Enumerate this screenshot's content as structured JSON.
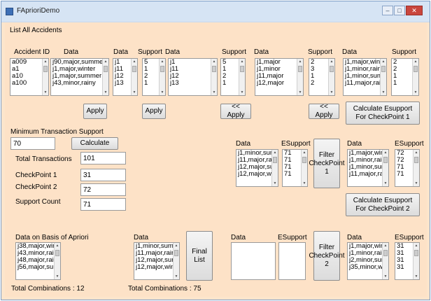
{
  "window": {
    "title": "FAprioriDemo",
    "min": "–",
    "max": "□",
    "close": "✕"
  },
  "section_title": "List All Accidents",
  "col_labels": {
    "accident_id": "Accident ID",
    "data1": "Data",
    "data2": "Data",
    "support1": "Support",
    "data3": "Data",
    "support2": "Support",
    "data4": "Data",
    "support3": "Support",
    "data5": "Data",
    "support4": "Support"
  },
  "lists": {
    "accident_ids": [
      "a009",
      "a1",
      "a10",
      "a100"
    ],
    "data1": [
      "j90,major,summer",
      "j1,major,winter",
      "j1,major,summer",
      "j43,minor,rainy"
    ],
    "data2": [
      "j1",
      "j11",
      "j12",
      "j13"
    ],
    "support1": [
      "5",
      "1",
      "2",
      "1"
    ],
    "data3": [
      "j1",
      "j11",
      "j12",
      "j13"
    ],
    "support2": [
      "5",
      "1",
      "2",
      "1"
    ],
    "data4": [
      "j1,major",
      "j1,minor",
      "j11,major",
      "j12,major"
    ],
    "support3": [
      "2",
      "3",
      "1",
      "2"
    ],
    "data5": [
      "j1,major,winter",
      "j1,minor,rainy",
      "j1,minor,summ",
      "j11,major,rainy"
    ],
    "support4": [
      "2",
      "2",
      "1",
      "1"
    ],
    "filter1_data": [
      "j1,minor,summ",
      "j11,major,rainy",
      "j12,major,sumi",
      "j12,major,winte"
    ],
    "filter1_esupport": [
      "71",
      "71",
      "71",
      "71"
    ],
    "cp1_data": [
      "j1,major,winter",
      "j1,minor,rainy",
      "j1,minor,summ",
      "j11,major,rainy"
    ],
    "cp1_esupport": [
      "72",
      "72",
      "71",
      "71"
    ],
    "apriori": [
      "j38,major,winte",
      "j43,minor,rainy",
      "j48,major,rainy",
      "j56,major,sumi"
    ],
    "final_data": [
      "j1,minor,summ",
      "j11,major,rainy",
      "j12,major,sumi",
      "j12,major,winte"
    ],
    "cp2_data": [
      "j1,major,winter",
      "j1,minor,rainy",
      "j2,minor,summ",
      "j35,minor,winte"
    ],
    "cp2_esupport": [
      "31",
      "31",
      "31",
      "31"
    ]
  },
  "buttons": {
    "apply1": "Apply",
    "apply2": "Apply",
    "apply_back1": "<< Apply",
    "apply_back2": "<< Apply",
    "calc_cp1": "Calculate Esupport For CheckPoint 1",
    "calculate": "Calculate",
    "filter_cp1": "Filter CheckPoint 1",
    "calc_cp2": "Calculate Esupport For CheckPoint 2",
    "final_list": "Final List",
    "filter_cp2": "Filter CheckPoint 2"
  },
  "form": {
    "min_support_label": "Minimum Transaction Support",
    "min_support_value": "70",
    "total_tx_label": "Total Transactions",
    "total_tx_value": "101",
    "cp1_label": "CheckPoint 1",
    "cp1_value": "31",
    "cp2_label": "CheckPoint 2",
    "cp2_value": "72",
    "support_count_label": "Support Count",
    "support_count_value": "71"
  },
  "right_labels": {
    "data_a": "Data",
    "esupport_a": "ESupport",
    "data_b": "Data",
    "esupport_b": "ESupport",
    "data_c": "Data",
    "esupport_c": "ESupport",
    "data_d": "Data",
    "esupport_d": "ESupport"
  },
  "bottom": {
    "apriori_label": "Data on Basis of Apriori",
    "final_data_label": "Data",
    "total_combinations_1": "Total Combinations : 12",
    "total_combinations_2": "Total Combinations : 75"
  }
}
